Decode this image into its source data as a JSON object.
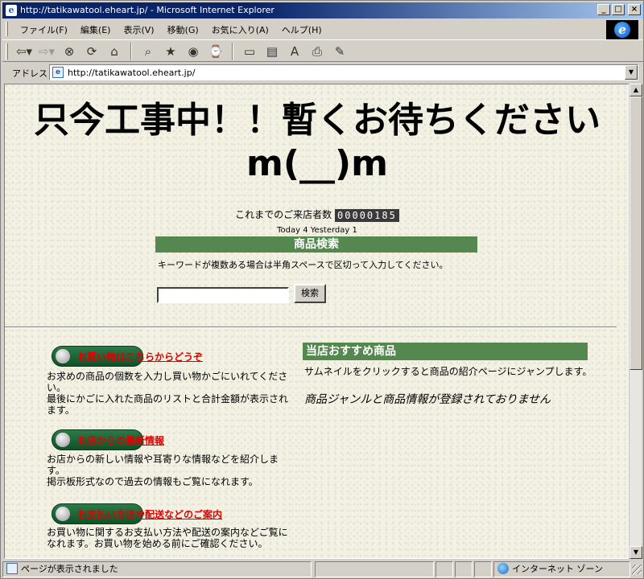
{
  "window": {
    "title": "http://tatikawatool.eheart.jp/ - Microsoft Internet Explorer",
    "buttons": {
      "minimize": "_",
      "maximize": "□",
      "close": "×"
    }
  },
  "menubar": {
    "items": [
      "ファイル(F)",
      "編集(E)",
      "表示(V)",
      "移動(G)",
      "お気に入り(A)",
      "ヘルプ(H)"
    ]
  },
  "toolbar": {
    "icons": [
      "back-icon",
      "forward-icon",
      "stop-icon",
      "refresh-icon",
      "home-icon",
      "search-icon",
      "favorites-icon",
      "media-icon",
      "history-icon",
      "fullscreen-icon",
      "channels-icon",
      "font-icon",
      "print-icon",
      "edit-icon"
    ]
  },
  "addressbar": {
    "label": "アドレス",
    "url": "http://tatikawatool.eheart.jp/"
  },
  "page": {
    "headline": "只今工事中！！暫くお待ちください m(__)m",
    "visitor_label": "これまでのご来店者数",
    "visitor_count": "00000185",
    "today_yesterday": "Today 4 Yesterday 1",
    "search": {
      "title": "商品検索",
      "note": "キーワードが複数ある場合は半角スペースで区切って入力してください。",
      "input_value": "",
      "button_label": "検索"
    },
    "sections": [
      {
        "link": "お買い物はこちらからどうぞ",
        "text": "お求めの商品の個数を入力し買い物かごにいれてください。\n最後にかごに入れた商品のリストと合計金額が表示されます。"
      },
      {
        "link": "お店からの最新情報",
        "text": "お店からの新しい情報や耳寄りな情報などを紹介します。\n掲示板形式なので過去の情報もご覧になれます。"
      },
      {
        "link": "お支払い方法や配送などのご案内",
        "text": "お買い物に関するお支払い方法や配送の案内などご覧になれます。お買い物を始める前にご確認ください。"
      }
    ],
    "recommend": {
      "title": "当店おすすめ商品",
      "note": "サムネイルをクリックすると商品の紹介ページにジャンプします。",
      "empty": "商品ジャンルと商品情報が登録されておりません"
    }
  },
  "statusbar": {
    "message": "ページが表示されました",
    "zone": "インターネット ゾーン"
  },
  "colors": {
    "title_bar": "#0a246a",
    "section_header": "#54884f",
    "link_red": "#e00000",
    "pill_green": "#0e5228"
  }
}
